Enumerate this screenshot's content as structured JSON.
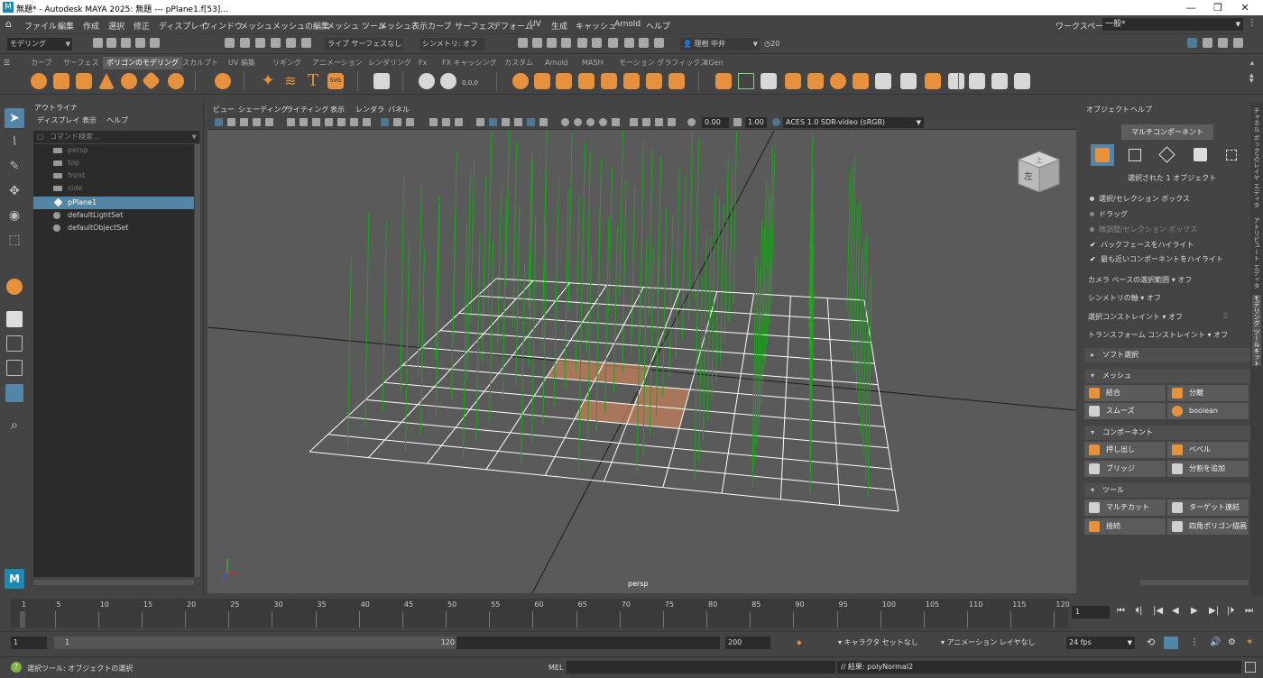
{
  "window": {
    "title": "無題* - Autodesk MAYA 2025: 無題   ---   pPlane1.f[53]...",
    "app_icon": "M",
    "controls": [
      "—",
      "❐",
      "✕"
    ]
  },
  "menubar": {
    "items": [
      "ファイル",
      "編集",
      "作成",
      "選択",
      "修正",
      "ディスプレイ",
      "ウィンドウ",
      "メッシュ",
      "メッシュの編集",
      "メッシュ ツール",
      "メッシュ表示",
      "カーブ",
      "サーフェス",
      "デフォーム",
      "UV",
      "生成",
      "キャッシュ",
      "Arnold",
      "ヘルプ"
    ],
    "workspace_label": "ワークスペース:",
    "workspace_value": "一般*"
  },
  "statusline": {
    "menuset": "モデリング",
    "live_label": "ライブ",
    "live_value": "サーフェスなし",
    "symmetry": "シンメトリ: オフ",
    "user": "理樹 中井",
    "credits": "20"
  },
  "shelf": {
    "tabs": [
      "カーブ",
      "サーフェス",
      "ポリゴンのモデリング",
      "スカルプト",
      "UV 編集",
      "リギング",
      "アニメーション",
      "レンダリング",
      "Fx",
      "FX キャッシング",
      "カスタム",
      "Arnold",
      "MASH",
      "モーション グラフィックス",
      "XGen"
    ],
    "active_tab": 2,
    "text_icon": "T",
    "svg_icon": "SVG",
    "coord_label": "0,0,0"
  },
  "outliner": {
    "header": "アウトライナ",
    "menus": [
      "ディスプレイ",
      "表示",
      "ヘルプ"
    ],
    "search_placeholder": "コマンド検索...",
    "items": [
      {
        "label": "persp",
        "dim": true
      },
      {
        "label": "top",
        "dim": true
      },
      {
        "label": "front",
        "dim": true
      },
      {
        "label": "side",
        "dim": true
      },
      {
        "label": "pPlane1",
        "selected": true
      },
      {
        "label": "defaultLightSet"
      },
      {
        "label": "defaultObjectSet"
      }
    ]
  },
  "viewport": {
    "menus": [
      "ビュー",
      "シェーディング",
      "ライティング",
      "表示",
      "レンダラ",
      "パネル"
    ],
    "exposure": "0.00",
    "gamma": "1.00",
    "colorspace": "ACES 1.0 SDR-video (sRGB)",
    "camera": "persp",
    "viewcube_label": "左",
    "viewcube_top": "上",
    "colors": {
      "grid_line": "#1e1e1e",
      "mesh_wire": "#ffffff",
      "normals": "#1fa31f",
      "face_selection": "#c9825a"
    }
  },
  "modeling_toolkit": {
    "menus": [
      "オブジェクト",
      "ヘルプ"
    ],
    "multi_component": "マルチコンポーネント",
    "selected_info": "選択された 1 オブジェクト",
    "select_options": [
      {
        "label": "選択/セレクション ボックス",
        "active": true
      },
      {
        "label": "ドラッグ",
        "active": false
      },
      {
        "label": "微調整/セレクション ボックス",
        "active": false
      }
    ],
    "checkboxes": [
      "バックフェースをハイライト",
      "最も近いコンポーネントをハイライト"
    ],
    "rows": [
      {
        "label": "カメラ ベースの選択範囲",
        "value": "オフ"
      },
      {
        "label": "シンメトリの軸",
        "value": "オフ"
      },
      {
        "label": "選択コンストレイント",
        "value": "オフ",
        "extra": "0"
      },
      {
        "label": "トランスフォーム コンストレイント",
        "value": "オフ"
      }
    ],
    "soft_select": "ソフト選択",
    "mesh_section": "メッシュ",
    "mesh_buttons": [
      "結合",
      "分離",
      "スムーズ",
      "boolean"
    ],
    "component_section": "コンポーネント",
    "component_buttons": [
      "押し出し",
      "ベベル",
      "ブリッジ",
      "分割を追加"
    ],
    "tool_section": "ツール",
    "tool_buttons": [
      "マルチカット",
      "ターゲット連結",
      "接続",
      "四角ポリゴン描画"
    ]
  },
  "side_tabs": [
    "チャネル ボックス/レイヤ エディタ",
    "アトリビュート エディタ",
    "モデリング ツールキット"
  ],
  "timeline": {
    "ticks": [
      1,
      5,
      10,
      15,
      20,
      25,
      30,
      35,
      40,
      45,
      50,
      55,
      60,
      65,
      70,
      75,
      80,
      85,
      90,
      95,
      100,
      105,
      110,
      115,
      120
    ],
    "current_frame": "1",
    "playback_icons": [
      "⏮",
      "⏴|",
      "|◀",
      "◀",
      "▶",
      "▶|",
      "|⏵",
      "⏭"
    ]
  },
  "range": {
    "start": "1",
    "inner_start": "1",
    "inner_end": "120",
    "end": "200",
    "character_set": "キャラクタ セットなし",
    "anim_layer": "アニメーション レイヤなし",
    "fps": "24 fps"
  },
  "commandline": {
    "help": "選択ツール: オブジェクトの選択",
    "mel_label": "MEL",
    "result": "// 結果: polyNormal2"
  }
}
